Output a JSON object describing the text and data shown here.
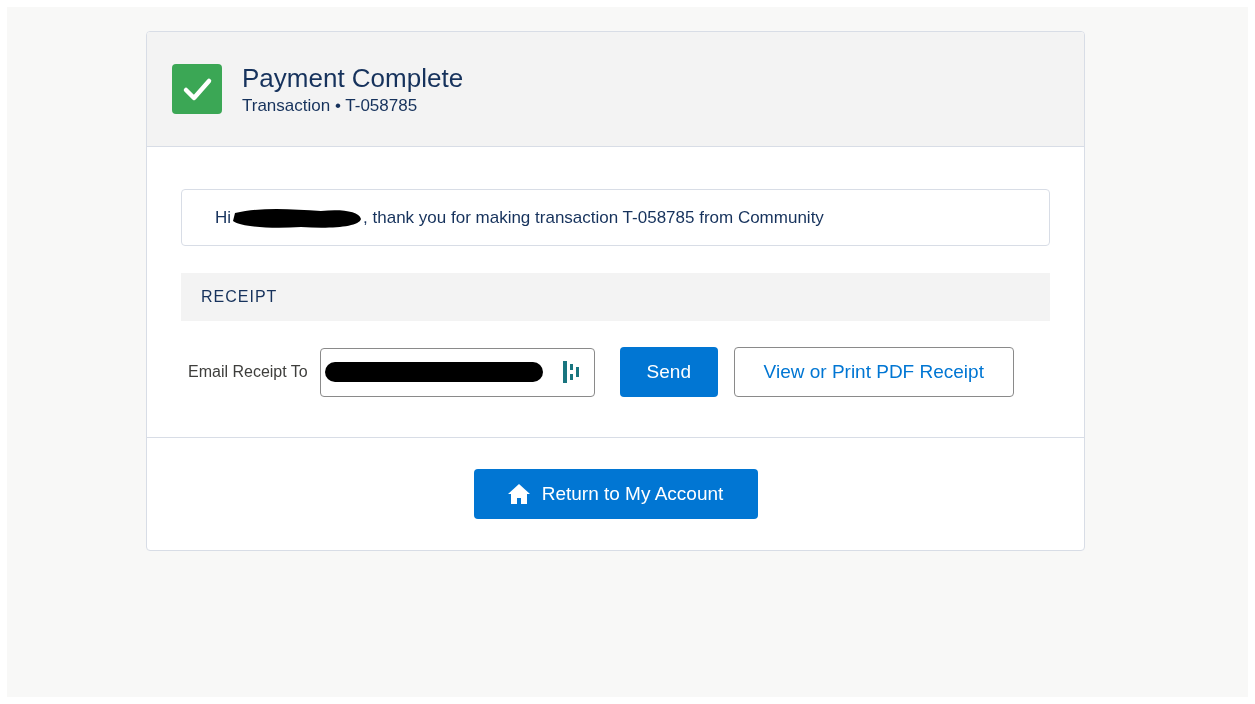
{
  "header": {
    "title": "Payment Complete",
    "subtitle": "Transaction • T-058785"
  },
  "message": {
    "greeting": "Hi",
    "text": ", thank you for making transaction T-058785 from Community"
  },
  "receipt": {
    "section_title": "RECEIPT",
    "email_label": "Email Receipt To",
    "send_button": "Send",
    "pdf_button": "View or Print PDF Receipt"
  },
  "footer": {
    "return_button": "Return to My Account"
  }
}
